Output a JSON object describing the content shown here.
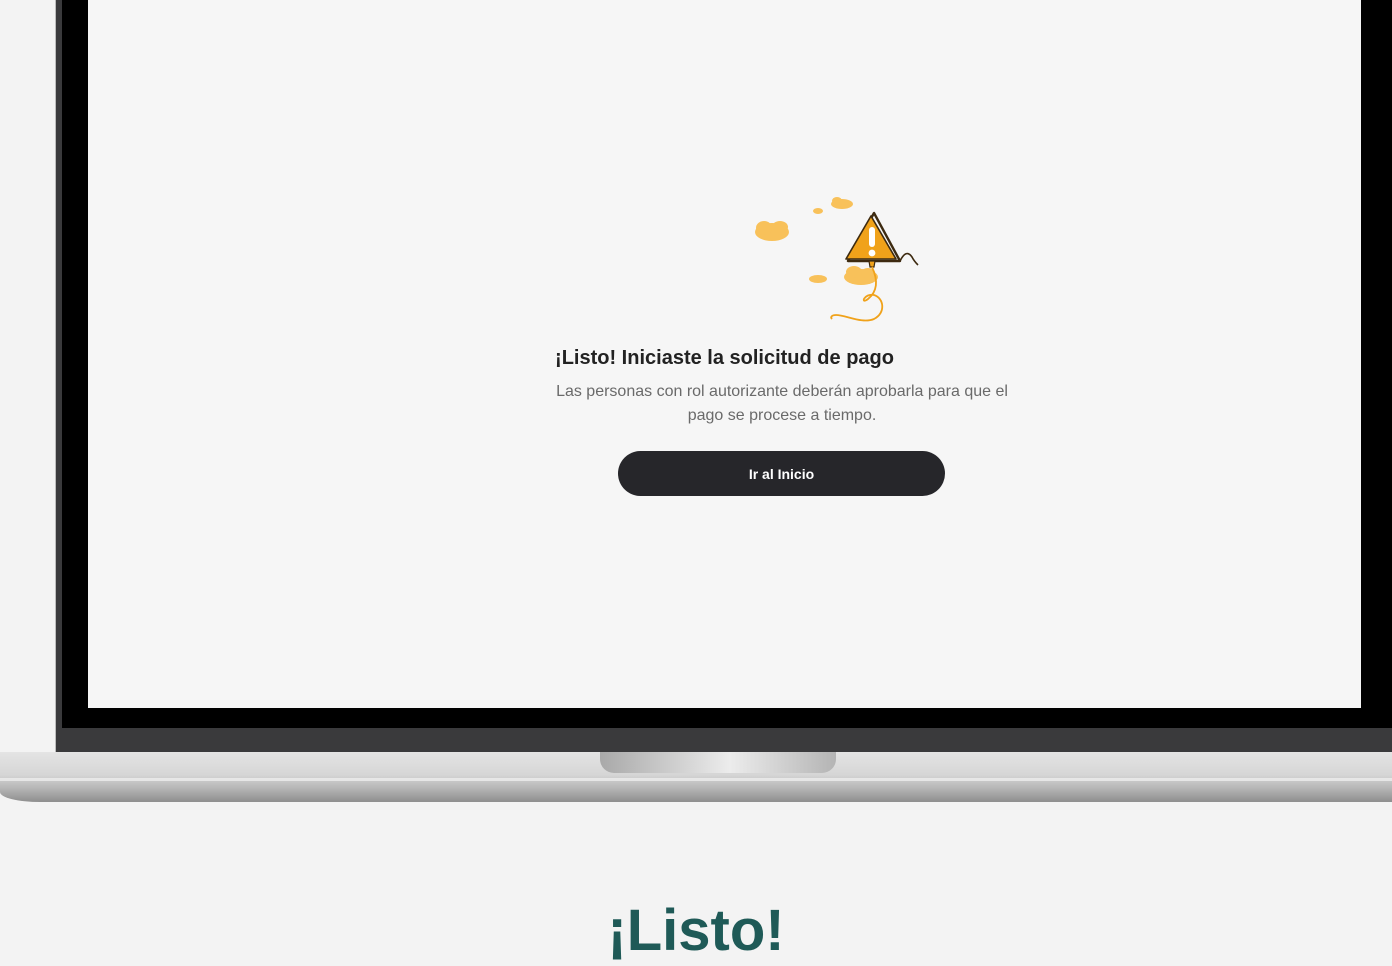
{
  "dialog": {
    "title": "¡Listo! Iniciaste la solicitud de pago",
    "description": "Las personas con rol autorizante deberán aprobarla para que el pago se procese a tiempo.",
    "primary_button_label": "Ir al Inicio"
  },
  "illustration": {
    "icon": "warning-balloon-icon",
    "accent_color": "#f0a21a",
    "cloud_color": "#f8c15a"
  },
  "footer": {
    "heading": "¡Listo!"
  },
  "colors": {
    "button": "#26262a",
    "heading_bottom": "#1f5a57"
  }
}
